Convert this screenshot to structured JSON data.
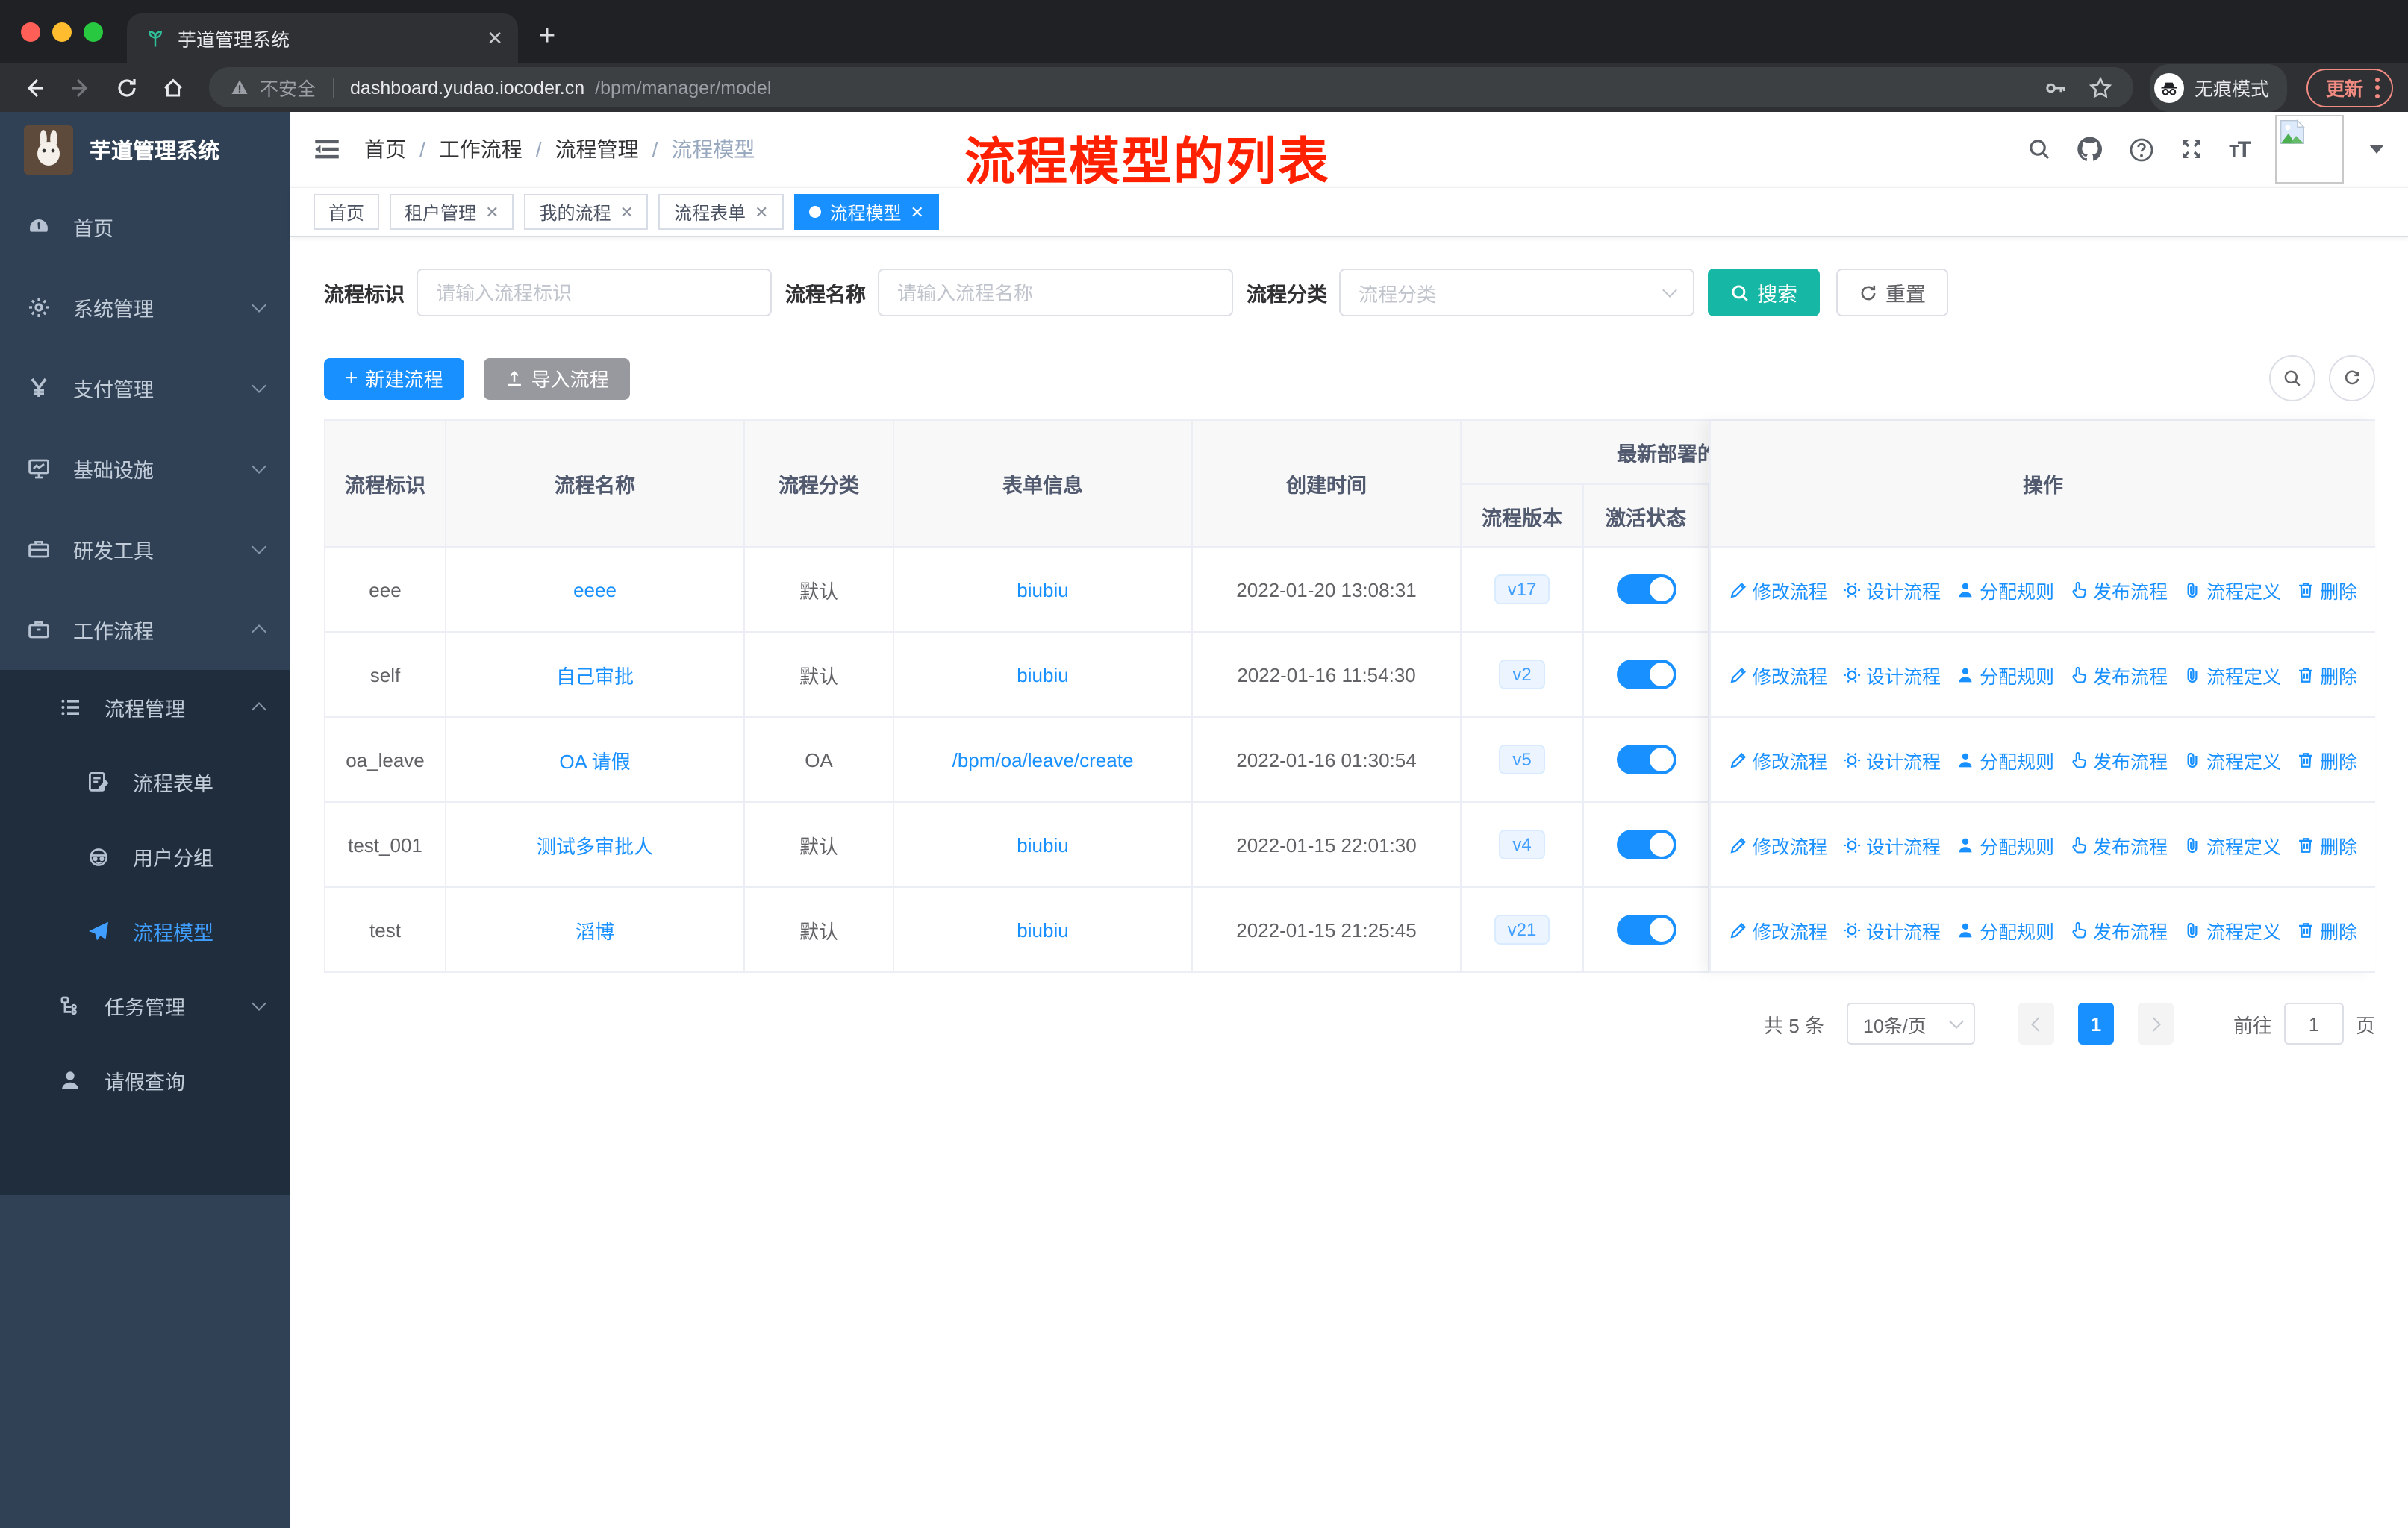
{
  "browser": {
    "tab_title": "芋道管理系统",
    "security_label": "不安全",
    "url_host": "dashboard.yudao.iocoder.cn",
    "url_path": "/bpm/manager/model",
    "incognito_label": "无痕模式",
    "update_label": "更新"
  },
  "sidebar": {
    "title": "芋道管理系统",
    "items": {
      "home": "首页",
      "system": "系统管理",
      "payment": "支付管理",
      "infra": "基础设施",
      "devtools": "研发工具",
      "workflow": "工作流程",
      "process_mgmt": "流程管理",
      "process_form": "流程表单",
      "user_group": "用户分组",
      "process_model": "流程模型",
      "task_mgmt": "任务管理",
      "leave_query": "请假查询"
    }
  },
  "header": {
    "breadcrumb": [
      "首页",
      "工作流程",
      "流程管理",
      "流程模型"
    ],
    "annotation": "流程模型的列表"
  },
  "tags": [
    {
      "label": "首页"
    },
    {
      "label": "租户管理"
    },
    {
      "label": "我的流程"
    },
    {
      "label": "流程表单"
    },
    {
      "label": "流程模型"
    }
  ],
  "filters": {
    "key_label": "流程标识",
    "key_placeholder": "请输入流程标识",
    "name_label": "流程名称",
    "name_placeholder": "请输入流程名称",
    "category_label": "流程分类",
    "category_placeholder": "流程分类",
    "search": "搜索",
    "reset": "重置"
  },
  "toolbar": {
    "create": "新建流程",
    "import": "导入流程"
  },
  "table": {
    "headers": {
      "key": "流程标识",
      "name": "流程名称",
      "category": "流程分类",
      "form": "表单信息",
      "created": "创建时间",
      "deploy_group": "最新部署的",
      "version": "流程版本",
      "active": "激活状态",
      "actions": "操作"
    },
    "actions": [
      "修改流程",
      "设计流程",
      "分配规则",
      "发布流程",
      "流程定义",
      "删除"
    ],
    "rows": [
      {
        "key": "eee",
        "name": "eeee",
        "category": "默认",
        "form": "biubiu",
        "created": "2022-01-20 13:08:31",
        "version": "v17",
        "active": true
      },
      {
        "key": "self",
        "name": "自己审批",
        "category": "默认",
        "form": "biubiu",
        "created": "2022-01-16 11:54:30",
        "version": "v2",
        "active": true
      },
      {
        "key": "oa_leave",
        "name": "OA 请假",
        "category": "OA",
        "form": "/bpm/oa/leave/create",
        "created": "2022-01-16 01:30:54",
        "version": "v5",
        "active": true
      },
      {
        "key": "test_001",
        "name": "测试多审批人",
        "category": "默认",
        "form": "biubiu",
        "created": "2022-01-15 22:01:30",
        "version": "v4",
        "active": true
      },
      {
        "key": "test",
        "name": "滔博",
        "category": "默认",
        "form": "biubiu",
        "created": "2022-01-15 21:25:45",
        "version": "v21",
        "active": true
      }
    ]
  },
  "pagination": {
    "total": "共 5 条",
    "page_size": "10条/页",
    "page": "1",
    "goto_label": "前往",
    "goto_value": "1",
    "goto_suffix": "页"
  },
  "colors": {
    "accent": "#1890ff",
    "search_teal": "#16b7a5",
    "sidebar_bg": "#304156",
    "submenu_bg": "#1f2d3d",
    "annotation_red": "#ff2000",
    "active_toggle": "#1890ff"
  }
}
